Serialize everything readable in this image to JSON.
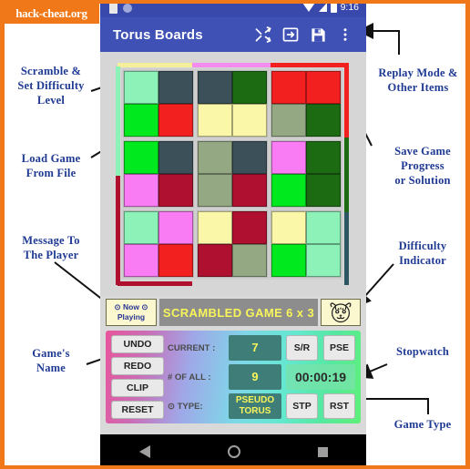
{
  "watermark": {
    "text": "hack-cheat.org"
  },
  "statusbar": {
    "time": "9:16",
    "icons": [
      "sim-icon",
      "circle-icon",
      "wifi-icon",
      "signal-icon",
      "battery-icon"
    ]
  },
  "appbar": {
    "title": "Torus Boards",
    "actions": [
      {
        "name": "shuffle-icon",
        "label": "Scramble"
      },
      {
        "name": "load-file-icon",
        "label": "Load"
      },
      {
        "name": "save-icon",
        "label": "Save"
      },
      {
        "name": "overflow-menu-icon",
        "label": "More"
      }
    ]
  },
  "board": {
    "rows": 6,
    "cols": 6,
    "blocks_per_row": 3,
    "edge_indicators": {
      "top": [
        "#f5ef9a",
        "#f48cf0",
        "#f32020"
      ],
      "left": [
        "#8df2b8",
        "#b01030"
      ],
      "right": [
        "#f32020",
        "#1c6b12",
        "#2b5662"
      ],
      "bottom": [
        "#b01030"
      ]
    },
    "palette": {
      "mint": "#8df2b8",
      "slate": "#3b5059",
      "darkgreen": "#1c6b12",
      "red": "#f32020",
      "green": "#00e81e",
      "cream": "#faf7a8",
      "sage": "#93a883",
      "magenta": "#f97cf5",
      "crimson": "#b01030"
    },
    "cells": [
      [
        "mint",
        "slate",
        "slate",
        "darkgreen",
        "red",
        "red"
      ],
      [
        "green",
        "red",
        "cream",
        "cream",
        "sage",
        "darkgreen"
      ],
      [
        "green",
        "slate",
        "sage",
        "slate",
        "magenta",
        "darkgreen"
      ],
      [
        "magenta",
        "crimson",
        "sage",
        "crimson",
        "green",
        "darkgreen"
      ],
      [
        "mint",
        "magenta",
        "cream",
        "crimson",
        "cream",
        "mint"
      ],
      [
        "magenta",
        "red",
        "crimson",
        "sage",
        "green",
        "mint"
      ]
    ]
  },
  "message_row": {
    "now_playing_line1": "⊙ Now ⊙",
    "now_playing_line2": "Playing",
    "message": "SCRAMBLED GAME 6 x 3",
    "difficulty_icon": "tiger-face-icon"
  },
  "control_panel": {
    "left_buttons": [
      "UNDO",
      "REDO",
      "CLIP",
      "RESET"
    ],
    "current_label": "CURRENT :",
    "current_value": "7",
    "all_label": "# OF ALL :",
    "all_value": "9",
    "type_label": "⊙ TYPE:",
    "type_value_line1": "PSEUDO",
    "type_value_line2": "TORUS",
    "sr_button": "S/R",
    "pse_button": "PSE",
    "stopwatch": "00:00:19",
    "stp_button": "STP",
    "rst_button": "RST"
  },
  "navbar": {
    "buttons": [
      "back-icon",
      "home-icon",
      "recents-icon"
    ]
  },
  "annotations": [
    {
      "id": "a1",
      "text": "Scramble &\nSet Difficulty\nLevel"
    },
    {
      "id": "a2",
      "text": "Load Game\nFrom File"
    },
    {
      "id": "a3",
      "text": "Message To\nThe Player"
    },
    {
      "id": "a4",
      "text": "Game's\nName"
    },
    {
      "id": "a5",
      "text": "Replay Mode &\nOther Items"
    },
    {
      "id": "a6",
      "text": "Save Game\nProgress\nor Solution"
    },
    {
      "id": "a7",
      "text": "Difficulty\nIndicator"
    },
    {
      "id": "a8",
      "text": "Stopwatch"
    },
    {
      "id": "a9",
      "text": "Game Type"
    }
  ]
}
